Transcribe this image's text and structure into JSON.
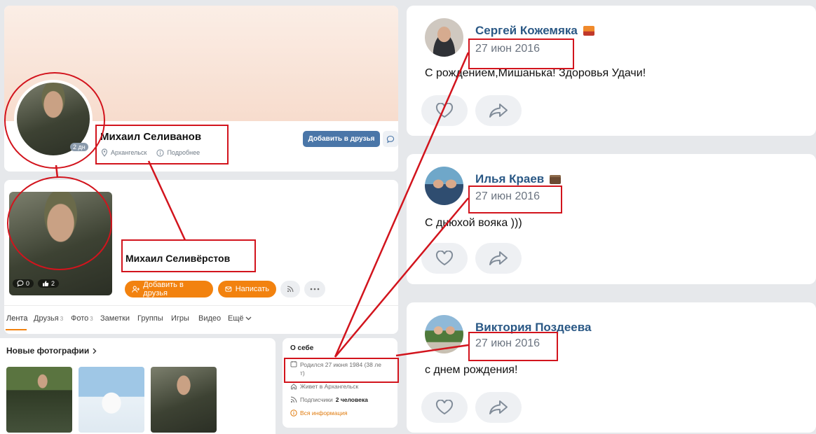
{
  "vk_profile": {
    "name": "Михаил Селиванов",
    "location": "Архангельск",
    "details_link": "Подробнее",
    "add_friend": "Добавить в друзья",
    "avatar_badge": "2 дн"
  },
  "ok_profile": {
    "name": "Михаил Селивёрстов",
    "comments_count": "0",
    "likes_count": "2",
    "add_friend": "Добавить в друзья",
    "write": "Написать",
    "tabs": [
      {
        "label": "Лента",
        "count": ""
      },
      {
        "label": "Друзья",
        "count": "3"
      },
      {
        "label": "Фото",
        "count": "3"
      },
      {
        "label": "Заметки",
        "count": ""
      },
      {
        "label": "Группы",
        "count": ""
      },
      {
        "label": "Игры",
        "count": ""
      },
      {
        "label": "Видео",
        "count": ""
      },
      {
        "label": "Ещё",
        "count": ""
      }
    ],
    "new_photos_title": "Новые фотографии",
    "about": {
      "title": "О себе",
      "born": "Родился 27 июня 1984 (38 ле\nт)",
      "lives": "Живет в Архангельск",
      "subscribers_label": "Подписчики",
      "subscribers_value": "2 человека",
      "all_info": "Вся информация"
    }
  },
  "comments": [
    {
      "author": "Сергей Кожемяка",
      "date": "27 июн 2016",
      "text": "С рождением,Мишанька! Здоровья Удачи!"
    },
    {
      "author": "Илья Краев",
      "date": "27 июн 2016",
      "text": "С днюхой вояка )))"
    },
    {
      "author": "Виктория Поздеева",
      "date": "27 июн 2016",
      "text": "с днем рождения!"
    }
  ],
  "colors": {
    "annotation_red": "#d2141d",
    "vk_blue": "#4a76a8",
    "ok_orange": "#f2820f"
  }
}
